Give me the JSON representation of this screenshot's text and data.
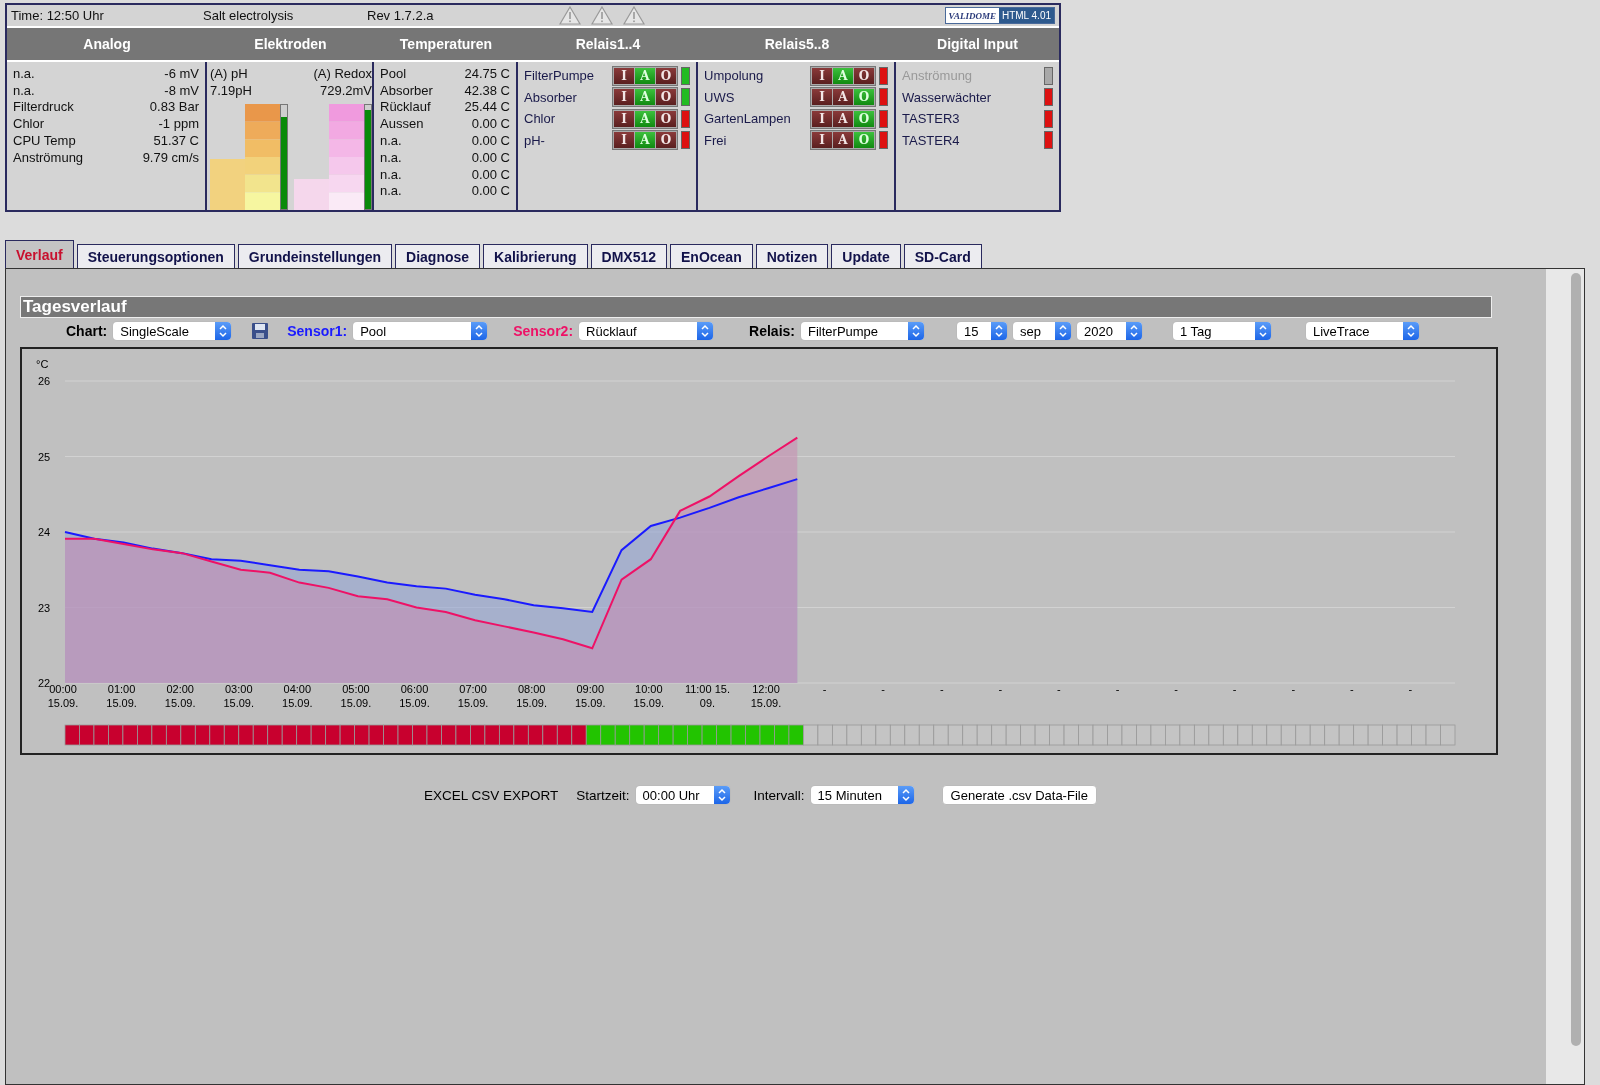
{
  "status_bar": {
    "time": "Time: 12:50 Uhr",
    "product": "Salt electrolysis",
    "revision": "Rev 1.7.2.a",
    "badge": {
      "logo": "VALIDOME",
      "label": "HTML 4.01"
    }
  },
  "panel_headers": [
    "Analog",
    "Elektroden",
    "Temperaturen",
    "Relais1..4",
    "Relais5..8",
    "Digital Input"
  ],
  "analog": [
    {
      "name": "n.a.",
      "value": "-6 mV"
    },
    {
      "name": "n.a.",
      "value": "-8 mV"
    },
    {
      "name": "Filterdruck",
      "value": "0.83 Bar"
    },
    {
      "name": "Chlor",
      "value": "-1 ppm"
    },
    {
      "name": "CPU Temp",
      "value": "51.37 C"
    },
    {
      "name": "Anströmung",
      "value": "9.79 cm/s"
    }
  ],
  "electrodes": [
    {
      "kind": "ph",
      "name": "(A) pH",
      "value": "7.19pH",
      "level": 0.88
    },
    {
      "kind": "redox",
      "name": "(A) Redox",
      "value": "729.2mV",
      "level": 0.95
    }
  ],
  "temperatures": [
    {
      "name": "Pool",
      "value": "24.75 C"
    },
    {
      "name": "Absorber",
      "value": "42.38 C"
    },
    {
      "name": "Rücklauf",
      "value": "25.44 C"
    },
    {
      "name": "Aussen",
      "value": "0.00 C"
    },
    {
      "name": "n.a.",
      "value": "0.00 C"
    },
    {
      "name": "n.a.",
      "value": "0.00 C"
    },
    {
      "name": "n.a.",
      "value": "0.00 C"
    },
    {
      "name": "n.a.",
      "value": "0.00 C"
    }
  ],
  "relays_1_4": [
    {
      "name": "FilterPumpe",
      "color": "#22bb22",
      "switch": [
        {
          "label": "I",
          "selected": false
        },
        {
          "label": "A",
          "selected": true
        },
        {
          "label": "O",
          "selected": false
        }
      ]
    },
    {
      "name": "Absorber",
      "color": "#22bb22",
      "switch": [
        {
          "label": "I",
          "selected": false
        },
        {
          "label": "A",
          "selected": true
        },
        {
          "label": "O",
          "selected": false
        }
      ]
    },
    {
      "name": "Chlor",
      "color": "#dd1111",
      "switch": [
        {
          "label": "I",
          "selected": false
        },
        {
          "label": "A",
          "selected": true
        },
        {
          "label": "O",
          "selected": false
        }
      ]
    },
    {
      "name": "pH-",
      "color": "#dd1111",
      "switch": [
        {
          "label": "I",
          "selected": false
        },
        {
          "label": "A",
          "selected": true
        },
        {
          "label": "O",
          "selected": false
        }
      ]
    }
  ],
  "relays_5_8": [
    {
      "name": "Umpolung",
      "color": "#dd1111",
      "switch": [
        {
          "label": "I",
          "selected": false
        },
        {
          "label": "A",
          "selected": true
        },
        {
          "label": "O",
          "selected": false
        }
      ]
    },
    {
      "name": "UWS",
      "color": "#dd1111",
      "switch": [
        {
          "label": "I",
          "selected": false
        },
        {
          "label": "A",
          "selected": false
        },
        {
          "label": "O",
          "selected": true
        }
      ]
    },
    {
      "name": "GartenLampen",
      "color": "#dd1111",
      "switch": [
        {
          "label": "I",
          "selected": false
        },
        {
          "label": "A",
          "selected": false
        },
        {
          "label": "O",
          "selected": true
        }
      ]
    },
    {
      "name": "Frei",
      "color": "#dd1111",
      "switch": [
        {
          "label": "I",
          "selected": false
        },
        {
          "label": "A",
          "selected": false
        },
        {
          "label": "O",
          "selected": true
        }
      ]
    }
  ],
  "digital_inputs": [
    {
      "name": "Anströmung",
      "disabled": true,
      "color": "#a8a8a8"
    },
    {
      "name": "Wasserwächter",
      "disabled": false,
      "color": "#dd1111"
    },
    {
      "name": "TASTER3",
      "disabled": false,
      "color": "#dd1111"
    },
    {
      "name": "TASTER4",
      "disabled": false,
      "color": "#dd1111"
    }
  ],
  "tabs": [
    {
      "label": "Verlauf",
      "selected": true
    },
    {
      "label": "Steuerungsoptionen",
      "selected": false
    },
    {
      "label": "Grundeinstellungen",
      "selected": false
    },
    {
      "label": "Diagnose",
      "selected": false
    },
    {
      "label": "Kalibrierung",
      "selected": false
    },
    {
      "label": "DMX512",
      "selected": false
    },
    {
      "label": "EnOcean",
      "selected": false
    },
    {
      "label": "Notizen",
      "selected": false
    },
    {
      "label": "Update",
      "selected": false
    },
    {
      "label": "SD-Card",
      "selected": false
    }
  ],
  "section_title": "Tagesverlauf",
  "toolbar": [
    {
      "kind": "select",
      "label": "Chart:",
      "color": "#000000",
      "value": "SingleScale"
    },
    {
      "kind": "save"
    },
    {
      "kind": "select",
      "label": "Sensor1:",
      "color": "#1a1aff",
      "value": "Pool"
    },
    {
      "kind": "select",
      "label": "Sensor2:",
      "color": "#ee1166",
      "value": "Rücklauf"
    },
    {
      "kind": "select",
      "label": "Relais:",
      "color": "#000000",
      "value": "FilterPumpe"
    },
    {
      "kind": "select",
      "value": "15"
    },
    {
      "kind": "select",
      "value": "sep"
    },
    {
      "kind": "select",
      "value": "2020"
    },
    {
      "kind": "select",
      "value": "1 Tag"
    },
    {
      "kind": "select",
      "value": "LiveTrace"
    }
  ],
  "chart_data": {
    "type": "area",
    "grid": true,
    "ylabel": "°C",
    "ylim": [
      22,
      26
    ],
    "yticks": [
      22,
      23,
      24,
      25,
      26
    ],
    "categories": [
      "00:00\n15.09.",
      null,
      "01:00\n15.09.",
      null,
      "02:00\n15.09.",
      null,
      "03:00\n15.09.",
      null,
      "04:00\n15.09.",
      null,
      "05:00\n15.09.",
      null,
      "06:00\n15.09.",
      null,
      "07:00\n15.09.",
      null,
      "08:00\n15.09.",
      null,
      "09:00\n15.09.",
      null,
      "10:00\n15.09.",
      null,
      "11:00 15.\n09.",
      null,
      "12:00\n15.09.",
      null,
      "-",
      null,
      "-",
      null,
      "-",
      null,
      "-",
      null,
      "-",
      null,
      "-",
      null,
      "-",
      null,
      "-",
      null,
      "-",
      null,
      "-",
      null,
      "-",
      null
    ],
    "series": [
      {
        "color": "#1a1aff",
        "values": [
          24.0,
          23.91,
          23.86,
          23.78,
          23.72,
          23.64,
          23.62,
          23.56,
          23.5,
          23.48,
          23.41,
          23.33,
          23.28,
          23.25,
          23.17,
          23.11,
          23.03,
          22.99,
          22.94,
          23.76,
          24.08,
          24.19,
          24.32,
          24.46,
          24.58,
          24.7,
          null,
          null,
          null,
          null,
          null,
          null,
          null,
          null,
          null,
          null,
          null,
          null,
          null,
          null,
          null,
          null,
          null,
          null,
          null,
          null,
          null,
          null
        ]
      },
      {
        "color": "#ee1166",
        "values": [
          23.91,
          23.91,
          23.84,
          23.77,
          23.72,
          23.61,
          23.5,
          23.46,
          23.33,
          23.26,
          23.15,
          23.11,
          23.0,
          22.94,
          22.83,
          22.75,
          22.67,
          22.58,
          22.46,
          23.37,
          23.64,
          24.28,
          24.47,
          24.74,
          25.0,
          25.25,
          null,
          null,
          null,
          null,
          null,
          null,
          null,
          null,
          null,
          null,
          null,
          null,
          null,
          null,
          null,
          null,
          null,
          null,
          null,
          null,
          null,
          null
        ]
      }
    ]
  },
  "relay_trace": [
    {
      "on": false
    },
    {
      "on": false
    },
    {
      "on": false
    },
    {
      "on": false
    },
    {
      "on": false
    },
    {
      "on": false
    },
    {
      "on": false
    },
    {
      "on": false
    },
    {
      "on": false
    },
    {
      "on": false
    },
    {
      "on": false
    },
    {
      "on": false
    },
    {
      "on": false
    },
    {
      "on": false
    },
    {
      "on": false
    },
    {
      "on": false
    },
    {
      "on": false
    },
    {
      "on": false
    },
    {
      "on": false
    },
    {
      "on": false
    },
    {
      "on": false
    },
    {
      "on": false
    },
    {
      "on": false
    },
    {
      "on": false
    },
    {
      "on": false
    },
    {
      "on": false
    },
    {
      "on": false
    },
    {
      "on": false
    },
    {
      "on": false
    },
    {
      "on": false
    },
    {
      "on": false
    },
    {
      "on": false
    },
    {
      "on": false
    },
    {
      "on": false
    },
    {
      "on": false
    },
    {
      "on": false
    },
    {
      "on": true
    },
    {
      "on": true
    },
    {
      "on": true
    },
    {
      "on": true
    },
    {
      "on": true
    },
    {
      "on": true
    },
    {
      "on": true
    },
    {
      "on": true
    },
    {
      "on": true
    },
    {
      "on": true
    },
    {
      "on": true
    },
    {
      "on": true
    },
    {
      "on": true
    },
    {
      "on": true
    },
    {
      "on": true
    }
  ],
  "export": {
    "title": "EXCEL CSV EXPORT",
    "start_label": "Startzeit:",
    "start_value": "00:00 Uhr",
    "interval_label": "Intervall:",
    "interval_value": "15 Minuten",
    "button": "Generate .csv Data-File"
  }
}
